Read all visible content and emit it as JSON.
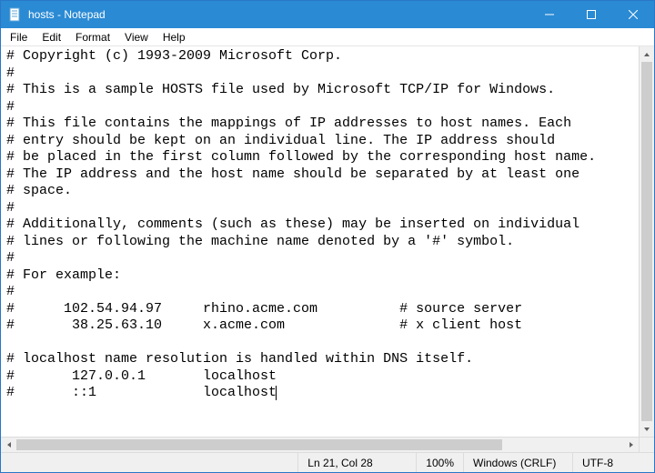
{
  "titlebar": {
    "title": "hosts - Notepad"
  },
  "menubar": {
    "items": [
      "File",
      "Edit",
      "Format",
      "View",
      "Help"
    ]
  },
  "editor": {
    "lines": [
      "# Copyright (c) 1993-2009 Microsoft Corp.",
      "#",
      "# This is a sample HOSTS file used by Microsoft TCP/IP for Windows.",
      "#",
      "# This file contains the mappings of IP addresses to host names. Each",
      "# entry should be kept on an individual line. The IP address should",
      "# be placed in the first column followed by the corresponding host name.",
      "# The IP address and the host name should be separated by at least one",
      "# space.",
      "#",
      "# Additionally, comments (such as these) may be inserted on individual",
      "# lines or following the machine name denoted by a '#' symbol.",
      "#",
      "# For example:",
      "#",
      "#      102.54.94.97     rhino.acme.com          # source server",
      "#       38.25.63.10     x.acme.com              # x client host",
      "",
      "# localhost name resolution is handled within DNS itself.",
      "#       127.0.0.1       localhost",
      "#       ::1             localhost"
    ]
  },
  "statusbar": {
    "position": "Ln 21, Col 28",
    "zoom": "100%",
    "line_ending": "Windows (CRLF)",
    "encoding": "UTF-8"
  }
}
